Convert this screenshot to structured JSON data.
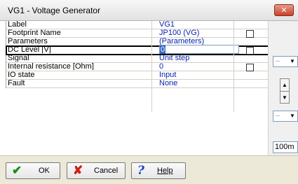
{
  "window": {
    "title": "VG1 - Voltage Generator",
    "close_glyph": "✕"
  },
  "properties": [
    {
      "label": "Label",
      "value": "VG1",
      "checkbox": false
    },
    {
      "label": "Footprint Name",
      "value": "JP100 (VG)",
      "checkbox": true
    },
    {
      "label": "Parameters",
      "value": "(Parameters)",
      "checkbox": false
    },
    {
      "label": "DC Level [V]",
      "value": "0",
      "checkbox": true,
      "selected": true
    },
    {
      "label": "Signal",
      "value": "Unit step",
      "checkbox": false
    },
    {
      "label": "Internal resistance [Ohm]",
      "value": "0",
      "checkbox": true
    },
    {
      "label": "IO state",
      "value": "Input",
      "checkbox": false
    },
    {
      "label": "Fault",
      "value": "None",
      "checkbox": false
    }
  ],
  "right_panel": {
    "combo1_value": "--",
    "combo2_value": "--",
    "input_value": "100m"
  },
  "buttons": {
    "ok": "OK",
    "cancel": "Cancel",
    "help": "Help"
  },
  "icons": {
    "ok": "check-icon",
    "cancel": "x-icon",
    "help": "question-icon"
  }
}
